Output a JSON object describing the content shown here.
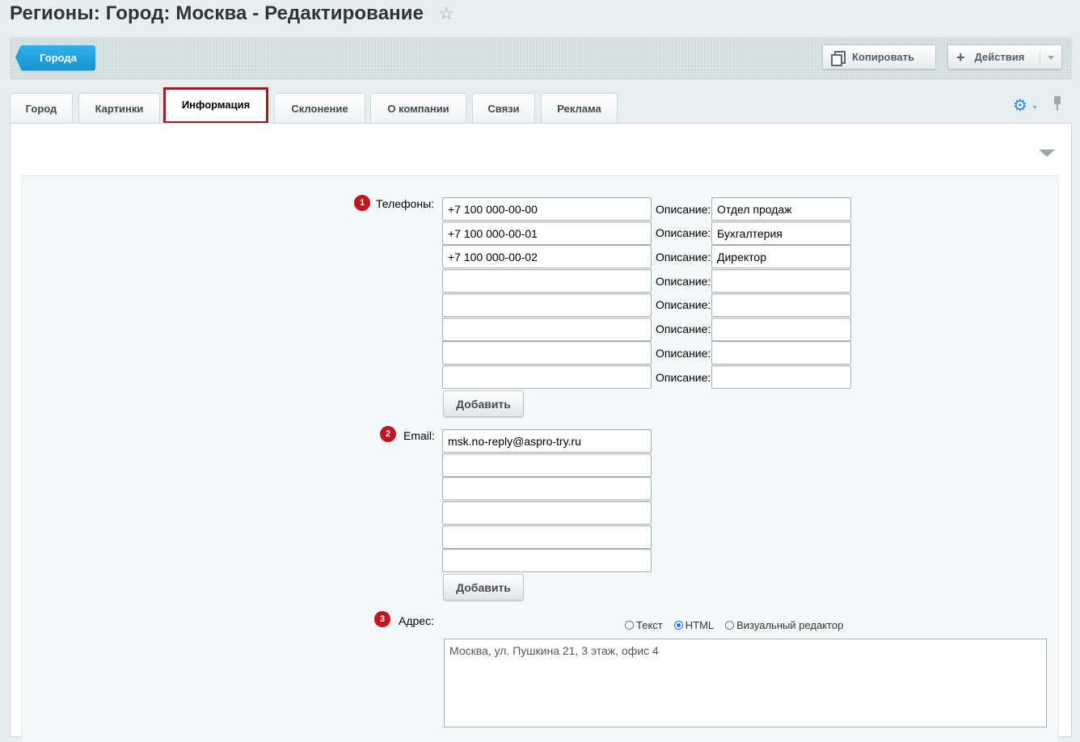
{
  "header": {
    "title": "Регионы: Город: Москва - Редактирование"
  },
  "toolbar": {
    "back_label": "Города",
    "copy_label": "Копировать",
    "actions_label": "Действия"
  },
  "tabs": [
    {
      "label": "Город"
    },
    {
      "label": "Картинки"
    },
    {
      "label": "Информация",
      "active": true
    },
    {
      "label": "Склонение"
    },
    {
      "label": "О компании"
    },
    {
      "label": "Связи"
    },
    {
      "label": "Реклама"
    }
  ],
  "form": {
    "phones": {
      "number": "1",
      "label": "Телефоны:",
      "desc_label": "Описание:",
      "rows": [
        {
          "phone": "+7 100 000-00-00",
          "desc": "Отдел продаж"
        },
        {
          "phone": "+7 100 000-00-01",
          "desc": "Бухгалтерия"
        },
        {
          "phone": "+7 100 000-00-02",
          "desc": "Директор"
        },
        {
          "phone": "",
          "desc": ""
        },
        {
          "phone": "",
          "desc": ""
        },
        {
          "phone": "",
          "desc": ""
        },
        {
          "phone": "",
          "desc": ""
        },
        {
          "phone": "",
          "desc": ""
        }
      ],
      "add_label": "Добавить"
    },
    "email": {
      "number": "2",
      "label": "Email:",
      "values": [
        "msk.no-reply@aspro-try.ru",
        "",
        "",
        "",
        "",
        ""
      ],
      "add_label": "Добавить"
    },
    "address": {
      "number": "3",
      "label": "Адрес:",
      "modes": [
        {
          "label": "Текст",
          "selected": false
        },
        {
          "label": "HTML",
          "selected": true
        },
        {
          "label": "Визуальный редактор",
          "selected": false
        }
      ],
      "value": "Москва, ул. Пушкина 21, 3 этаж, офис 4"
    }
  }
}
